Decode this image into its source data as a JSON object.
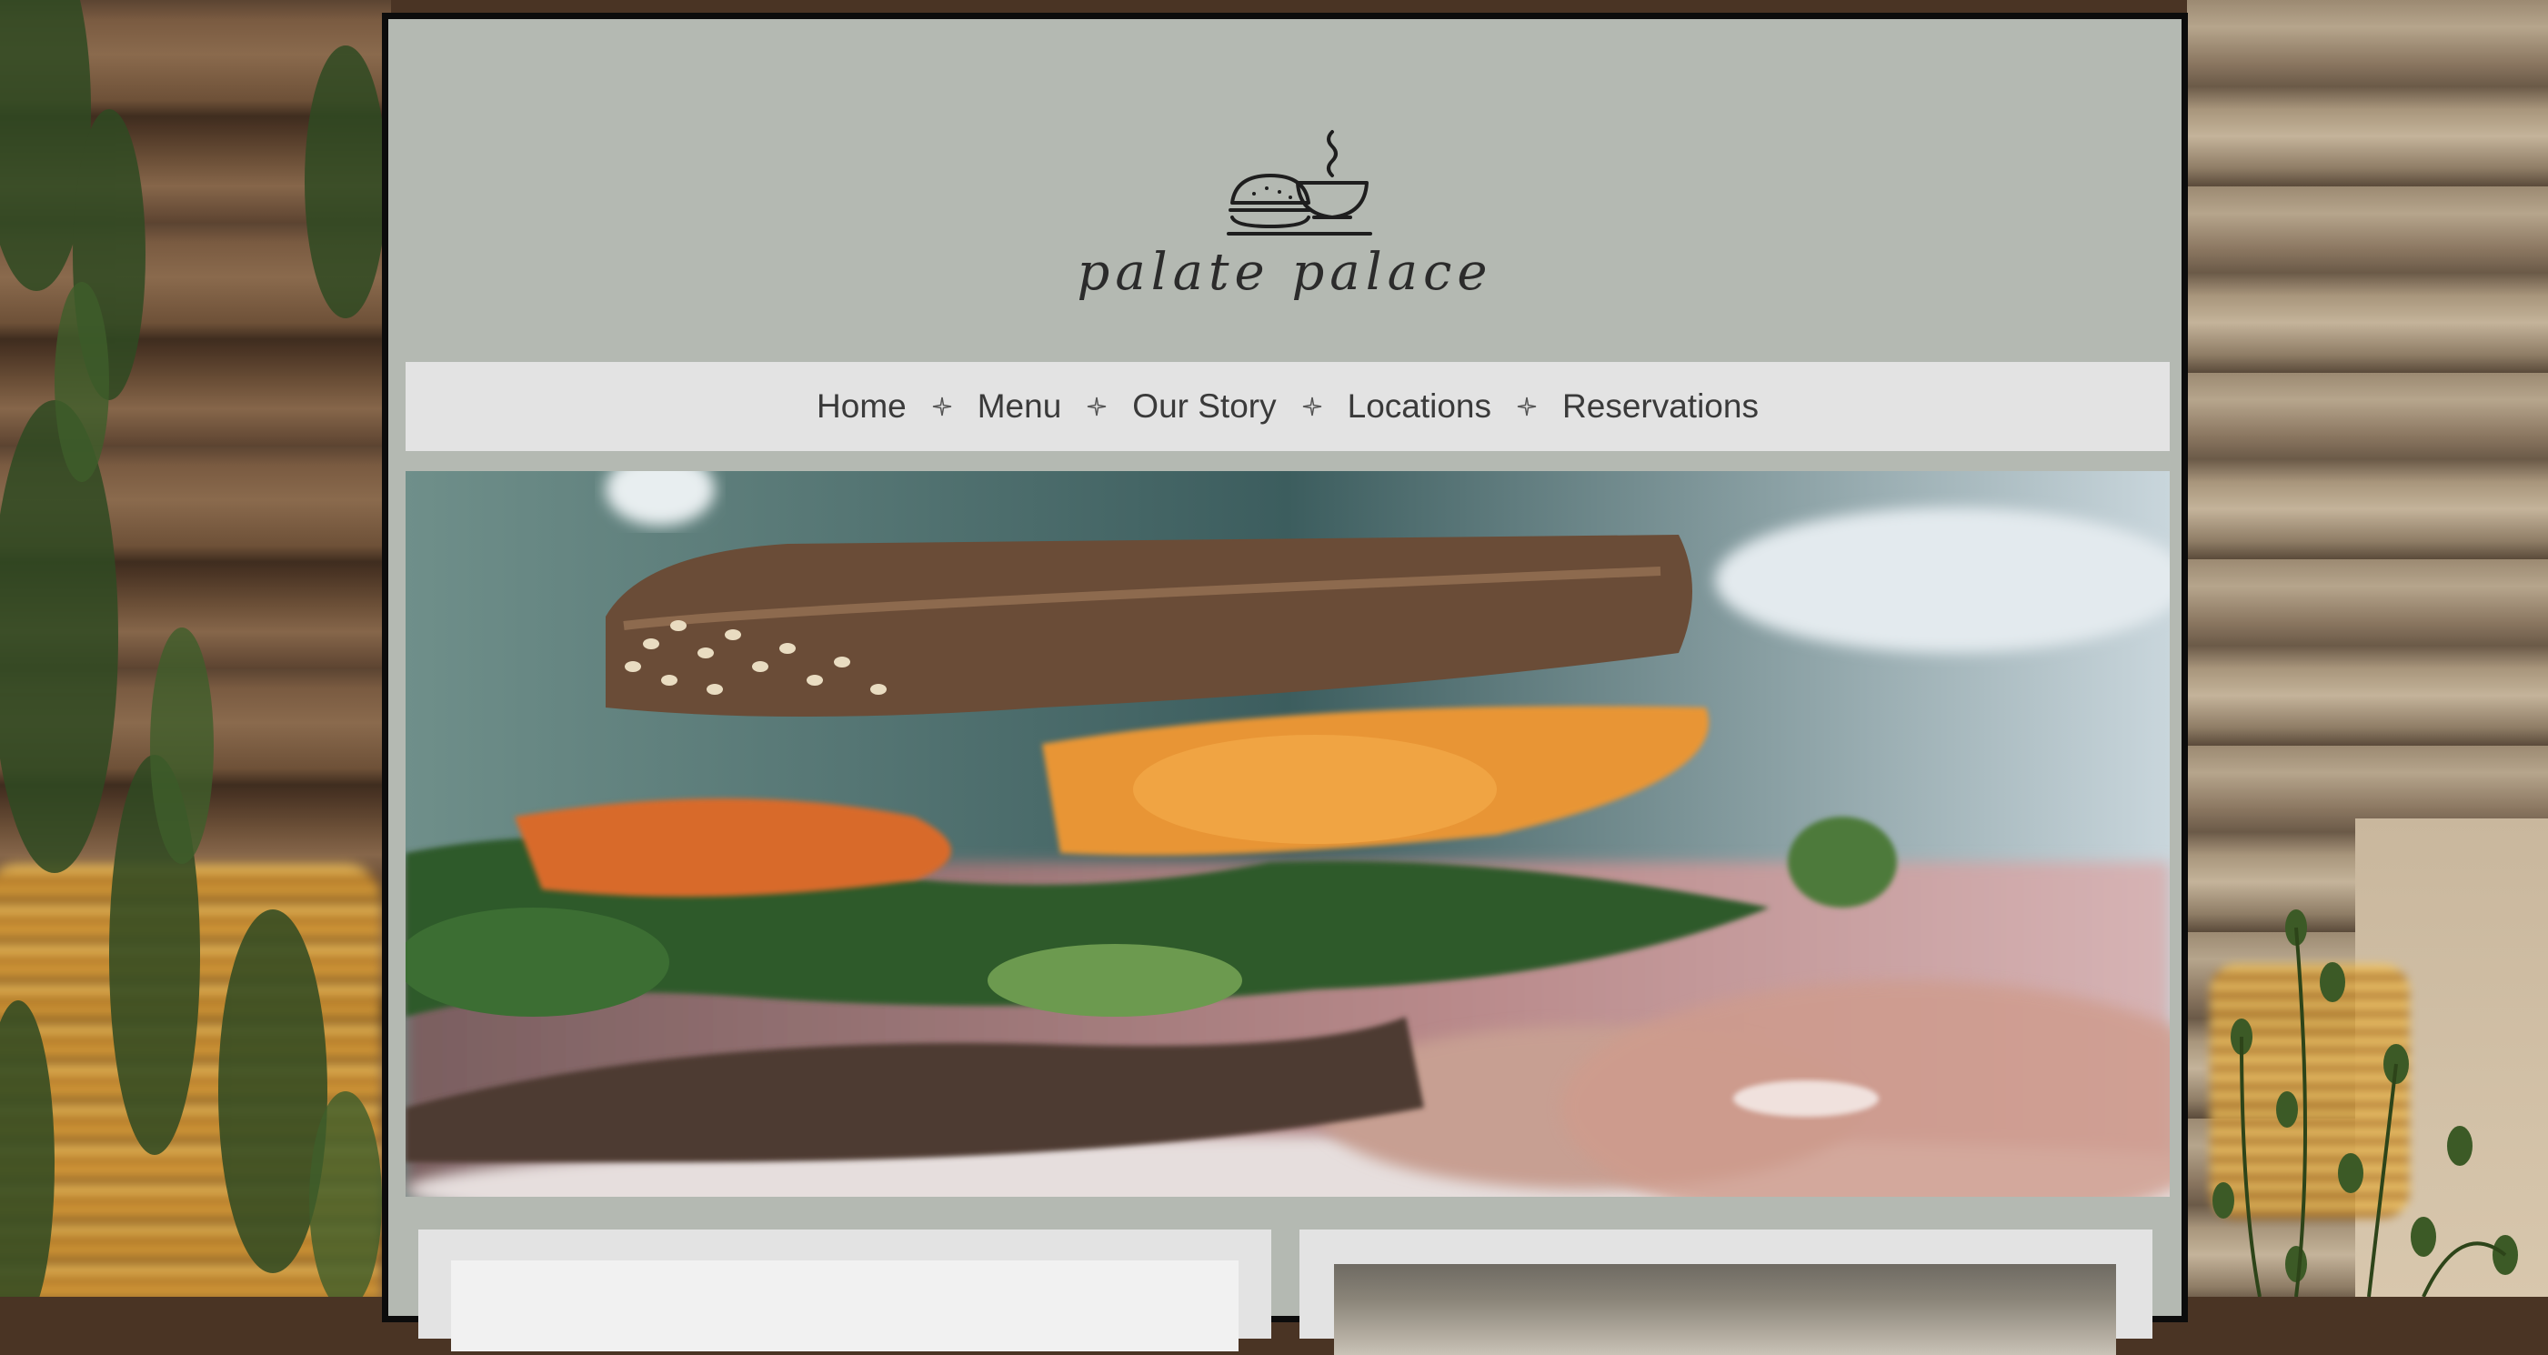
{
  "brand": {
    "name": "palate palace",
    "logo_icon": "sandwich-and-soup-bowl-icon"
  },
  "nav": {
    "items": [
      {
        "label": "Home"
      },
      {
        "label": "Menu"
      },
      {
        "label": "Our Story"
      },
      {
        "label": "Locations"
      },
      {
        "label": "Reservations"
      }
    ],
    "separator_icon": "four-point-star-icon"
  },
  "hero": {
    "image": "sandwich-closeup-photo"
  },
  "colors": {
    "page_bg": "#b4b9b2",
    "nav_bg": "#e3e3e3",
    "nav_text": "#3a3a3a",
    "frame": "#0c0c0c"
  }
}
